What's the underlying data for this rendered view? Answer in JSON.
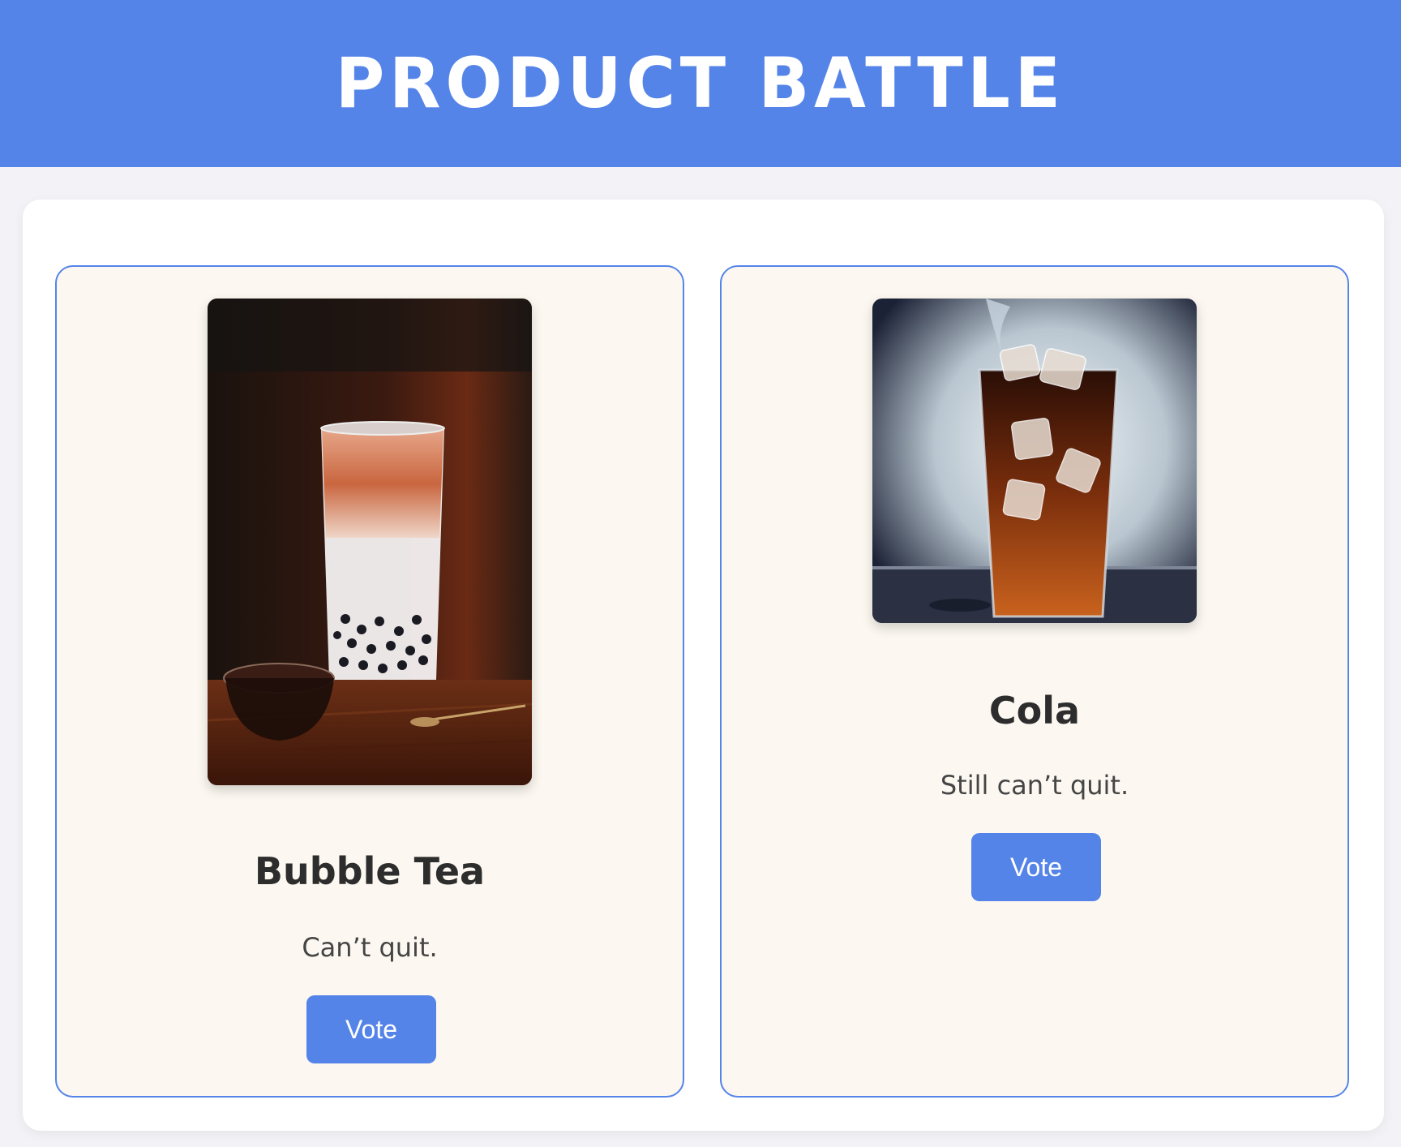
{
  "header": {
    "title": "PRODUCT BATTLE"
  },
  "products": [
    {
      "name": "Bubble Tea",
      "tagline": "Can’t quit.",
      "vote_label": "Vote",
      "image_alt": "bubble-tea-photo"
    },
    {
      "name": "Cola",
      "tagline": "Still can’t quit.",
      "vote_label": "Vote",
      "image_alt": "cola-photo"
    }
  ],
  "colors": {
    "accent": "#5584e9",
    "card_background": "#fcf8f1",
    "page_background": "#f3f3f7",
    "text_dark": "#2d2d2d"
  }
}
